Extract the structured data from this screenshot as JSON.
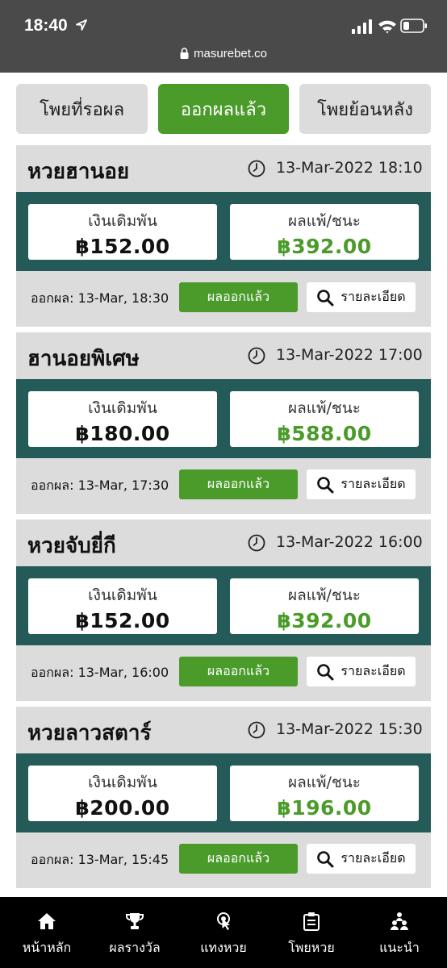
{
  "status_bar": {
    "time": "18:40"
  },
  "browser": {
    "url": "masurebet.co"
  },
  "tabs": [
    {
      "label": "โพยที่รอผล"
    },
    {
      "label": "ออกผลแล้ว"
    },
    {
      "label": "โพยย้อนหลัง"
    }
  ],
  "active_tab": "ออกผลแล้ว",
  "cards": [
    {
      "title": "หวยฮานอย",
      "datetime": "13-Mar-2022 18:10",
      "stake_label": "เงินเดิมพัน",
      "stake": "฿152.00",
      "result_label": "ผลแพ้/ชนะ",
      "result": "฿392.00",
      "issued": "ออกผล: 13-Mar, 18:30",
      "status": "ผลออกแล้ว",
      "detail_label": "รายละเอียด"
    },
    {
      "title": "ฮานอยพิเศษ",
      "datetime": "13-Mar-2022 17:00",
      "stake_label": "เงินเดิมพัน",
      "stake": "฿180.00",
      "result_label": "ผลแพ้/ชนะ",
      "result": "฿588.00",
      "issued": "ออกผล: 13-Mar, 17:30",
      "status": "ผลออกแล้ว",
      "detail_label": "รายละเอียด"
    },
    {
      "title": "หวยจับยี่กี",
      "datetime": "13-Mar-2022 16:00",
      "stake_label": "เงินเดิมพัน",
      "stake": "฿152.00",
      "result_label": "ผลแพ้/ชนะ",
      "result": "฿392.00",
      "issued": "ออกผล: 13-Mar, 16:00",
      "status": "ผลออกแล้ว",
      "detail_label": "รายละเอียด"
    },
    {
      "title": "หวยลาวสตาร์",
      "datetime": "13-Mar-2022 15:30",
      "stake_label": "เงินเดิมพัน",
      "stake": "฿200.00",
      "result_label": "ผลแพ้/ชนะ",
      "result": "฿196.00",
      "issued": "ออกผล: 13-Mar, 15:45",
      "status": "ผลออกแล้ว",
      "detail_label": "รายละเอียด"
    }
  ],
  "bottom_nav": [
    {
      "label": "หน้าหลัก",
      "icon": "home-icon"
    },
    {
      "label": "ผลรางวัล",
      "icon": "trophy-icon"
    },
    {
      "label": "แทงหวย",
      "icon": "touch-icon"
    },
    {
      "label": "โพยหวย",
      "icon": "clipboard-icon"
    },
    {
      "label": "แนะนำ",
      "icon": "people-icon"
    }
  ],
  "colors": {
    "accent_green": "#4a9b2a",
    "card_teal": "#245a57",
    "card_gray": "#dcdcdc",
    "status_bar": "#4a4a4a"
  }
}
